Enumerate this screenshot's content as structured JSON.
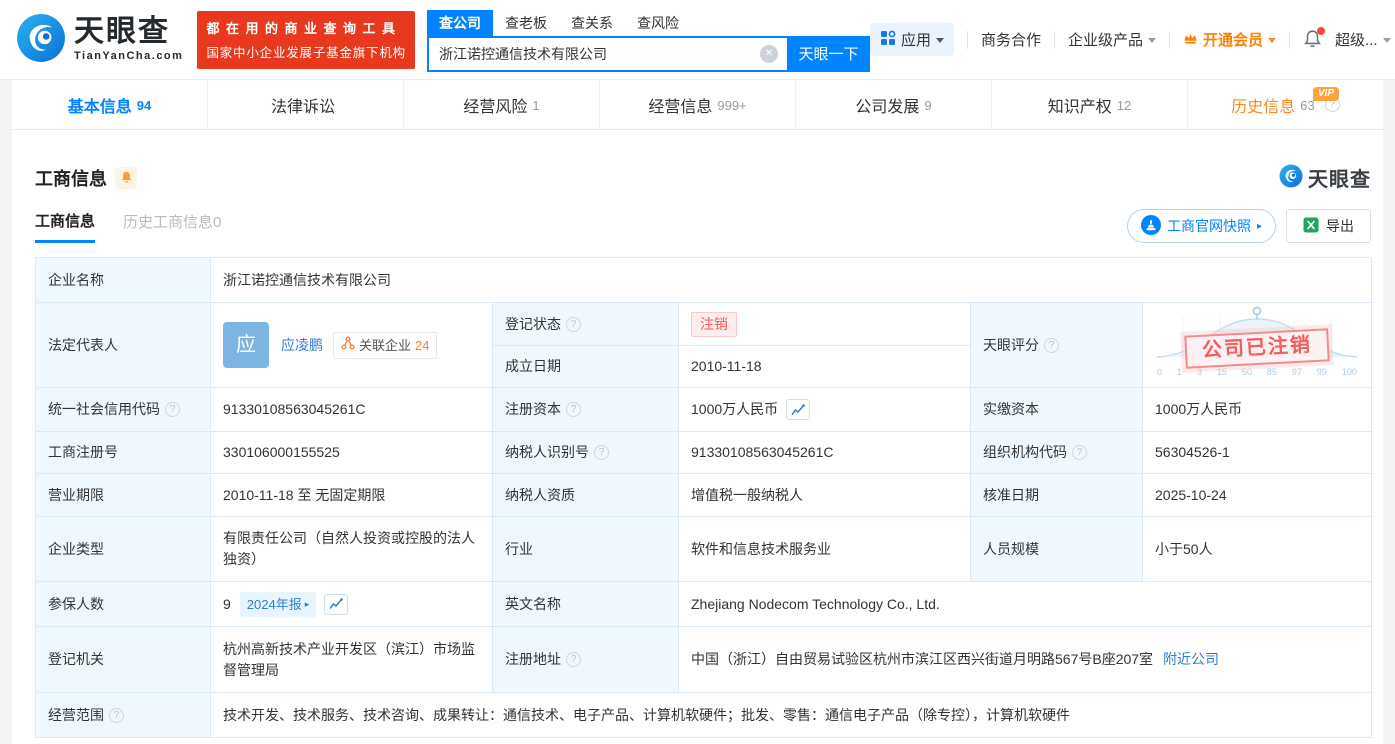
{
  "colors": {
    "accent": "#0084ff",
    "orange": "#ff8a1e",
    "red": "#f45a5a",
    "excel_green": "#21a366",
    "banner_red": "#e8391f"
  },
  "icons": {
    "help": "?",
    "clear": "✕",
    "arrow_right": "▸",
    "vip": "VIP"
  },
  "header": {
    "logo": {
      "title": "天眼查",
      "subtitle": "TianYanCha.com"
    },
    "banner": {
      "line1": "都在用的商业查询工具",
      "line2": "国家中小企业发展子基金旗下机构"
    },
    "search": {
      "tabs": [
        {
          "label": "查公司"
        },
        {
          "label": "查老板"
        },
        {
          "label": "查关系"
        },
        {
          "label": "查风险"
        }
      ],
      "value": "浙江诺控通信技术有限公司",
      "button": "天眼一下"
    },
    "nav": {
      "apps": "应用",
      "cooperation": "商务合作",
      "enterprise": "企业级产品",
      "vip": "开通会员",
      "super": "超级..."
    }
  },
  "tabs": [
    {
      "label": "基本信息",
      "count": "94"
    },
    {
      "label": "法律诉讼",
      "count": ""
    },
    {
      "label": "经营风险",
      "count": "1"
    },
    {
      "label": "经营信息",
      "count": "999+"
    },
    {
      "label": "公司发展",
      "count": "9"
    },
    {
      "label": "知识产权",
      "count": "12"
    },
    {
      "label": "历史信息",
      "count": "63"
    }
  ],
  "section": {
    "title": "工商信息",
    "watermark": "天眼查",
    "subtabs": [
      {
        "label": "工商信息"
      },
      {
        "label": "历史工商信息0"
      }
    ],
    "snapshot_button": "工商官网快照",
    "export_button": "导出"
  },
  "fields": {
    "company_name": {
      "label": "企业名称",
      "value": "浙江诺控通信技术有限公司"
    },
    "legal_rep": {
      "label": "法定代表人",
      "name": "应凌鹏",
      "avatar_char": "应",
      "related_label": "关联企业",
      "related_count": "24"
    },
    "reg_status": {
      "label": "登记状态",
      "value": "注销"
    },
    "establish_date": {
      "label": "成立日期",
      "value": "2010-11-18"
    },
    "credit_code": {
      "label": "统一社会信用代码",
      "value": "91330108563045261C"
    },
    "reg_capital": {
      "label": "注册资本",
      "value": "1000万人民币"
    },
    "paid_capital": {
      "label": "实缴资本",
      "value": "1000万人民币"
    },
    "reg_number": {
      "label": "工商注册号",
      "value": "330106000155525"
    },
    "taxpayer_id": {
      "label": "纳税人识别号",
      "value": "91330108563045261C"
    },
    "org_code": {
      "label": "组织机构代码",
      "value": "56304526-1"
    },
    "business_term": {
      "label": "营业期限",
      "value": "2010-11-18 至 无固定期限"
    },
    "taxpayer_quality": {
      "label": "纳税人资质",
      "value": "增值税一般纳税人"
    },
    "approval_date": {
      "label": "核准日期",
      "value": "2025-10-24"
    },
    "company_type": {
      "label": "企业类型",
      "value": "有限责任公司（自然人投资或控股的法人独资）"
    },
    "industry": {
      "label": "行业",
      "value": "软件和信息技术服务业"
    },
    "staff_size": {
      "label": "人员规模",
      "value": "小于50人"
    },
    "insured_count": {
      "label": "参保人数",
      "value": "9",
      "report_badge": "2024年报"
    },
    "english_name": {
      "label": "英文名称",
      "value": "Zhejiang Nodecom Technology Co., Ltd."
    },
    "reg_authority": {
      "label": "登记机关",
      "value": "杭州高新技术产业开发区（滨江）市场监督管理局"
    },
    "reg_address": {
      "label": "注册地址",
      "value": "中国（浙江）自由贸易试验区杭州市滨江区西兴街道月明路567号B座207室",
      "nearby_link": "附近公司"
    },
    "business_scope": {
      "label": "经营范围",
      "value": "技术开发、技术服务、技术咨询、成果转让：通信技术、电子产品、计算机软硬件；批发、零售：通信电子产品（除专控），计算机软硬件"
    }
  },
  "score": {
    "label": "天眼评分",
    "stamp": "公司已注销",
    "axis": [
      "0",
      "1",
      "3",
      "15",
      "50",
      "85",
      "97",
      "99",
      "100"
    ]
  }
}
